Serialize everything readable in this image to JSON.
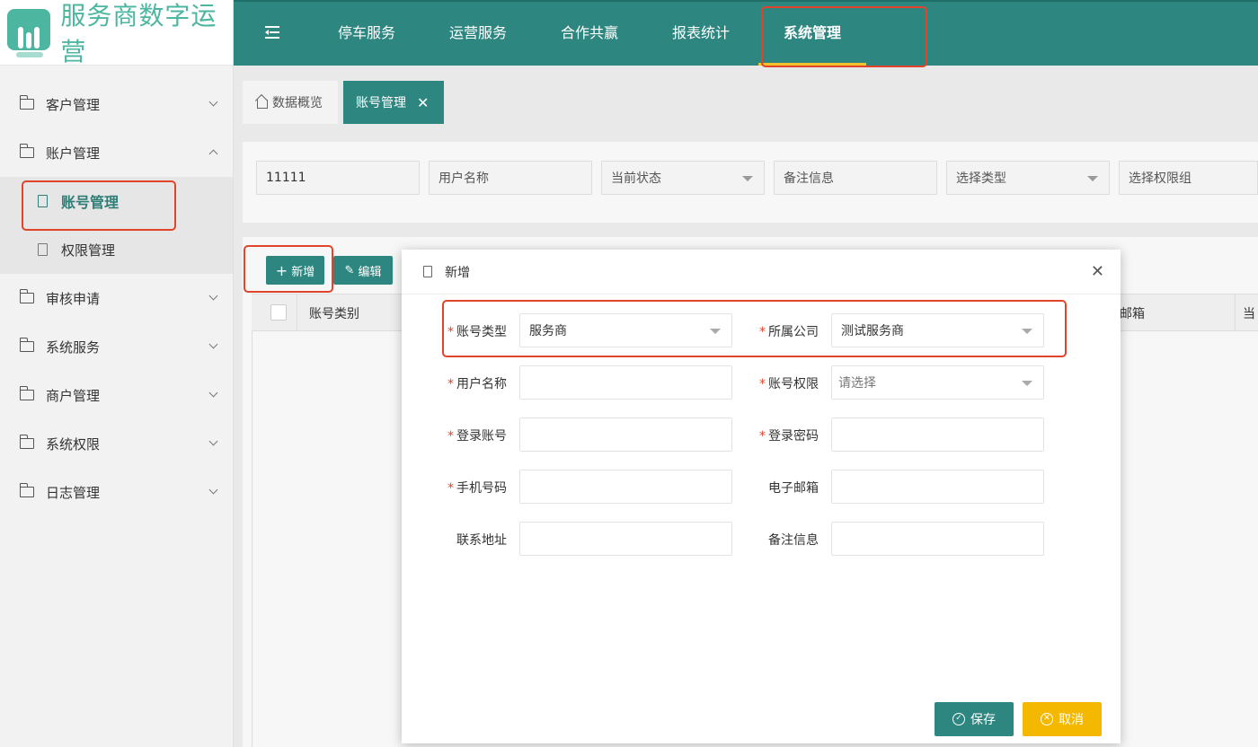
{
  "app": {
    "title": "服务商数字运营"
  },
  "colors": {
    "primary": "#2e8680",
    "accent": "#f3c12b",
    "highlight": "#e0452b",
    "cancel": "#f5b800"
  },
  "topnav": {
    "items": [
      {
        "label": "停车服务"
      },
      {
        "label": "运营服务"
      },
      {
        "label": "合作共赢"
      },
      {
        "label": "报表统计"
      },
      {
        "label": "系统管理",
        "active": true
      }
    ]
  },
  "sidebar": {
    "items": [
      {
        "label": "客户管理"
      },
      {
        "label": "账户管理",
        "expanded": true,
        "children": [
          {
            "label": "账号管理",
            "active": true
          },
          {
            "label": "权限管理"
          }
        ]
      },
      {
        "label": "审核申请"
      },
      {
        "label": "系统服务"
      },
      {
        "label": "商户管理"
      },
      {
        "label": "系统权限"
      },
      {
        "label": "日志管理"
      }
    ]
  },
  "tabs": [
    {
      "label": "数据概览",
      "icon": "home-icon"
    },
    {
      "label": "账号管理",
      "closable": true,
      "close": "✕"
    }
  ],
  "filters": [
    {
      "value": "11111"
    },
    {
      "placeholder": "用户名称"
    },
    {
      "placeholder": "当前状态",
      "dropdown": true
    },
    {
      "placeholder": "备注信息"
    },
    {
      "placeholder": "选择类型",
      "dropdown": true
    },
    {
      "placeholder": "选择权限组"
    }
  ],
  "toolbar": {
    "add_label": "新增",
    "edit_label": "编辑"
  },
  "table": {
    "columns": [
      "账号类别",
      "邮箱",
      "当"
    ]
  },
  "modal": {
    "title": "新增",
    "close": "✕",
    "fields": [
      {
        "label": "账号类型",
        "required": true,
        "value": "服务商",
        "dropdown": true
      },
      {
        "label": "所属公司",
        "required": true,
        "value": "测试服务商",
        "dropdown": true
      },
      {
        "label": "用户名称",
        "required": true,
        "value": ""
      },
      {
        "label": "账号权限",
        "required": true,
        "placeholder": "请选择",
        "dropdown": true
      },
      {
        "label": "登录账号",
        "required": true,
        "value": ""
      },
      {
        "label": "登录密码",
        "required": true,
        "value": ""
      },
      {
        "label": "手机号码",
        "required": true,
        "value": ""
      },
      {
        "label": "电子邮箱",
        "required": false,
        "value": ""
      },
      {
        "label": "联系地址",
        "required": false,
        "value": ""
      },
      {
        "label": "备注信息",
        "required": false,
        "value": ""
      }
    ],
    "save_label": "保存",
    "cancel_label": "取消"
  }
}
